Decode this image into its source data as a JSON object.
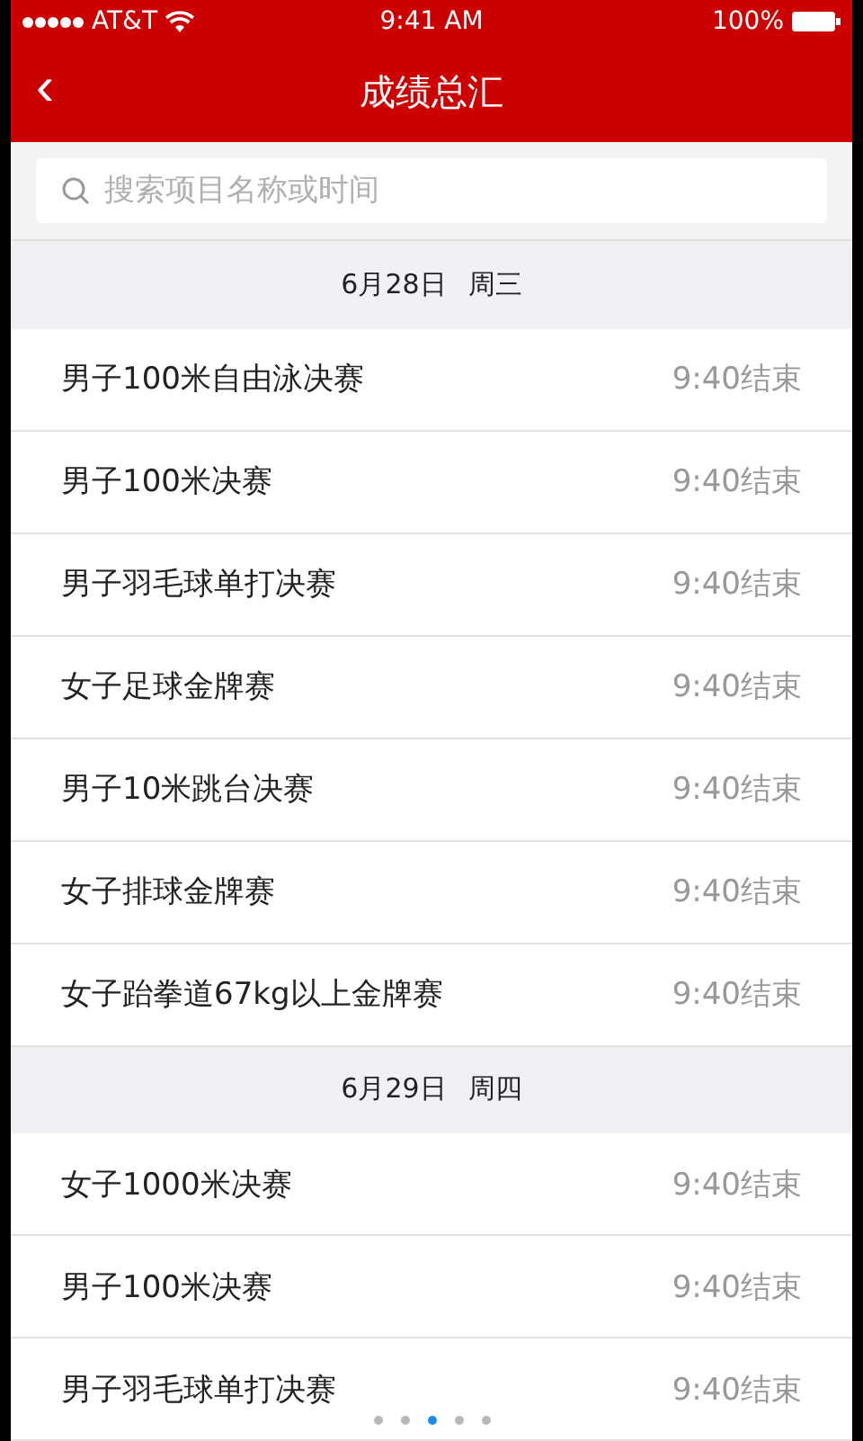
{
  "status_bar": {
    "carrier": "AT&T",
    "time": "9:41 AM",
    "battery": "100%"
  },
  "nav": {
    "back": "‹",
    "title": "成绩总汇"
  },
  "search": {
    "placeholder": "搜索项目名称或时间"
  },
  "sections": [
    {
      "date": "6月28日",
      "weekday": "周三",
      "rows": [
        {
          "name": "男子100米自由泳决赛",
          "status": "9:40结束"
        },
        {
          "name": "男子100米决赛",
          "status": "9:40结束"
        },
        {
          "name": "男子羽毛球单打决赛",
          "status": "9:40结束"
        },
        {
          "name": "女子足球金牌赛",
          "status": "9:40结束"
        },
        {
          "name": "男子10米跳台决赛",
          "status": "9:40结束"
        },
        {
          "name": "女子排球金牌赛",
          "status": "9:40结束"
        },
        {
          "name": "女子跆拳道67kg以上金牌赛",
          "status": "9:40结束"
        }
      ]
    },
    {
      "date": "6月29日",
      "weekday": "周四",
      "rows": [
        {
          "name": "女子1000米决赛",
          "status": "9:40结束"
        },
        {
          "name": "男子100米决赛",
          "status": "9:40结束"
        },
        {
          "name": "男子羽毛球单打决赛",
          "status": "9:40结束"
        }
      ]
    }
  ],
  "page_dots": [
    {
      "selected": false
    },
    {
      "selected": false
    },
    {
      "selected": true
    },
    {
      "selected": false
    },
    {
      "selected": false
    }
  ]
}
